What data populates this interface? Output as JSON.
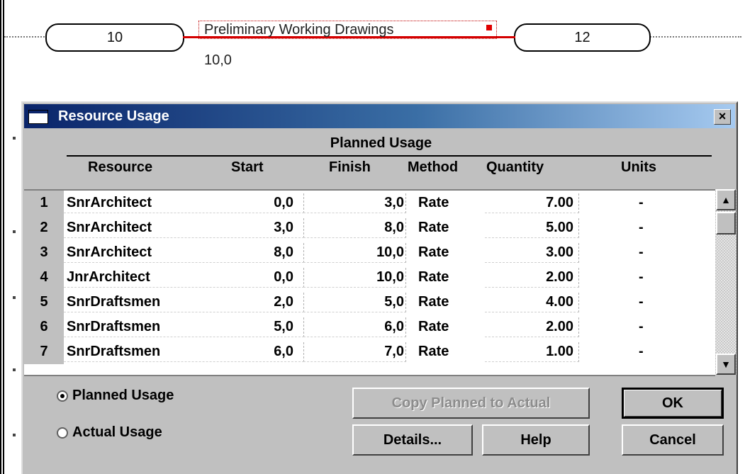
{
  "network": {
    "start_node": "10",
    "end_node": "12",
    "activity_name": "Preliminary Working Drawings",
    "activity_duration": "10,0"
  },
  "dialog": {
    "title": "Resource Usage",
    "close_glyph": "×",
    "group_header": "Planned Usage",
    "columns": [
      "Resource",
      "Start",
      "Finish",
      "Method",
      "Quantity",
      "Units"
    ],
    "rows": [
      {
        "n": "1",
        "resource": "SnrArchitect",
        "start": "0,0",
        "finish": "3,0",
        "method": "Rate",
        "quantity": "7.00",
        "units": "-"
      },
      {
        "n": "2",
        "resource": "SnrArchitect",
        "start": "3,0",
        "finish": "8,0",
        "method": "Rate",
        "quantity": "5.00",
        "units": "-"
      },
      {
        "n": "3",
        "resource": "SnrArchitect",
        "start": "8,0",
        "finish": "10,0",
        "method": "Rate",
        "quantity": "3.00",
        "units": "-"
      },
      {
        "n": "4",
        "resource": "JnrArchitect",
        "start": "0,0",
        "finish": "10,0",
        "method": "Rate",
        "quantity": "2.00",
        "units": "-"
      },
      {
        "n": "5",
        "resource": "SnrDraftsmen",
        "start": "2,0",
        "finish": "5,0",
        "method": "Rate",
        "quantity": "4.00",
        "units": "-"
      },
      {
        "n": "6",
        "resource": "SnrDraftsmen",
        "start": "5,0",
        "finish": "6,0",
        "method": "Rate",
        "quantity": "2.00",
        "units": "-"
      },
      {
        "n": "7",
        "resource": "SnrDraftsmen",
        "start": "6,0",
        "finish": "7,0",
        "method": "Rate",
        "quantity": "1.00",
        "units": "-"
      }
    ],
    "scroll_up_glyph": "▲",
    "scroll_down_glyph": "▼",
    "radio_planned": "Planned Usage",
    "radio_actual": "Actual Usage",
    "selected_mode": "Planned Usage",
    "buttons": {
      "copy": "Copy Planned to Actual",
      "ok": "OK",
      "details": "Details...",
      "help": "Help",
      "cancel": "Cancel"
    }
  }
}
